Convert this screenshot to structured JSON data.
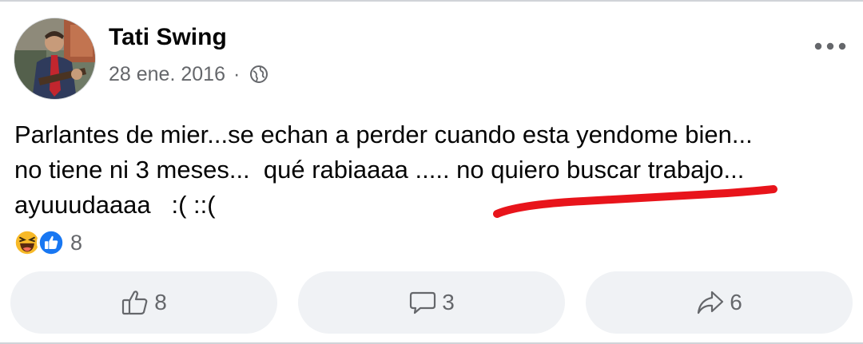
{
  "post": {
    "author": "Tati Swing",
    "date": "28 ene. 2016",
    "separator": "·",
    "privacy_icon": "globe-icon",
    "menu_icon": "more-options-icon",
    "text_lines": [
      "Parlantes de mier...se echan a perder cuando esta yendome bien...",
      "no tiene ni 3 meses...  qué rabiaaaa ..... no quiero buscar trabajo...",
      "ayuuudaaaa   :( ::("
    ],
    "annotation_color": "#e8141b"
  },
  "reactions": {
    "icons": [
      "haha-emoji-icon",
      "like-reaction-icon"
    ],
    "count": "8"
  },
  "actions": {
    "like": {
      "icon": "thumbs-up-icon",
      "count": "8"
    },
    "comment": {
      "icon": "comment-bubble-icon",
      "count": "3"
    },
    "share": {
      "icon": "share-arrow-icon",
      "count": "6"
    }
  },
  "colors": {
    "text": "#050505",
    "secondary_text": "#65676b",
    "button_bg": "#f0f2f5",
    "like_blue": "#1877f2",
    "haha_yellow": "#f7b928"
  }
}
